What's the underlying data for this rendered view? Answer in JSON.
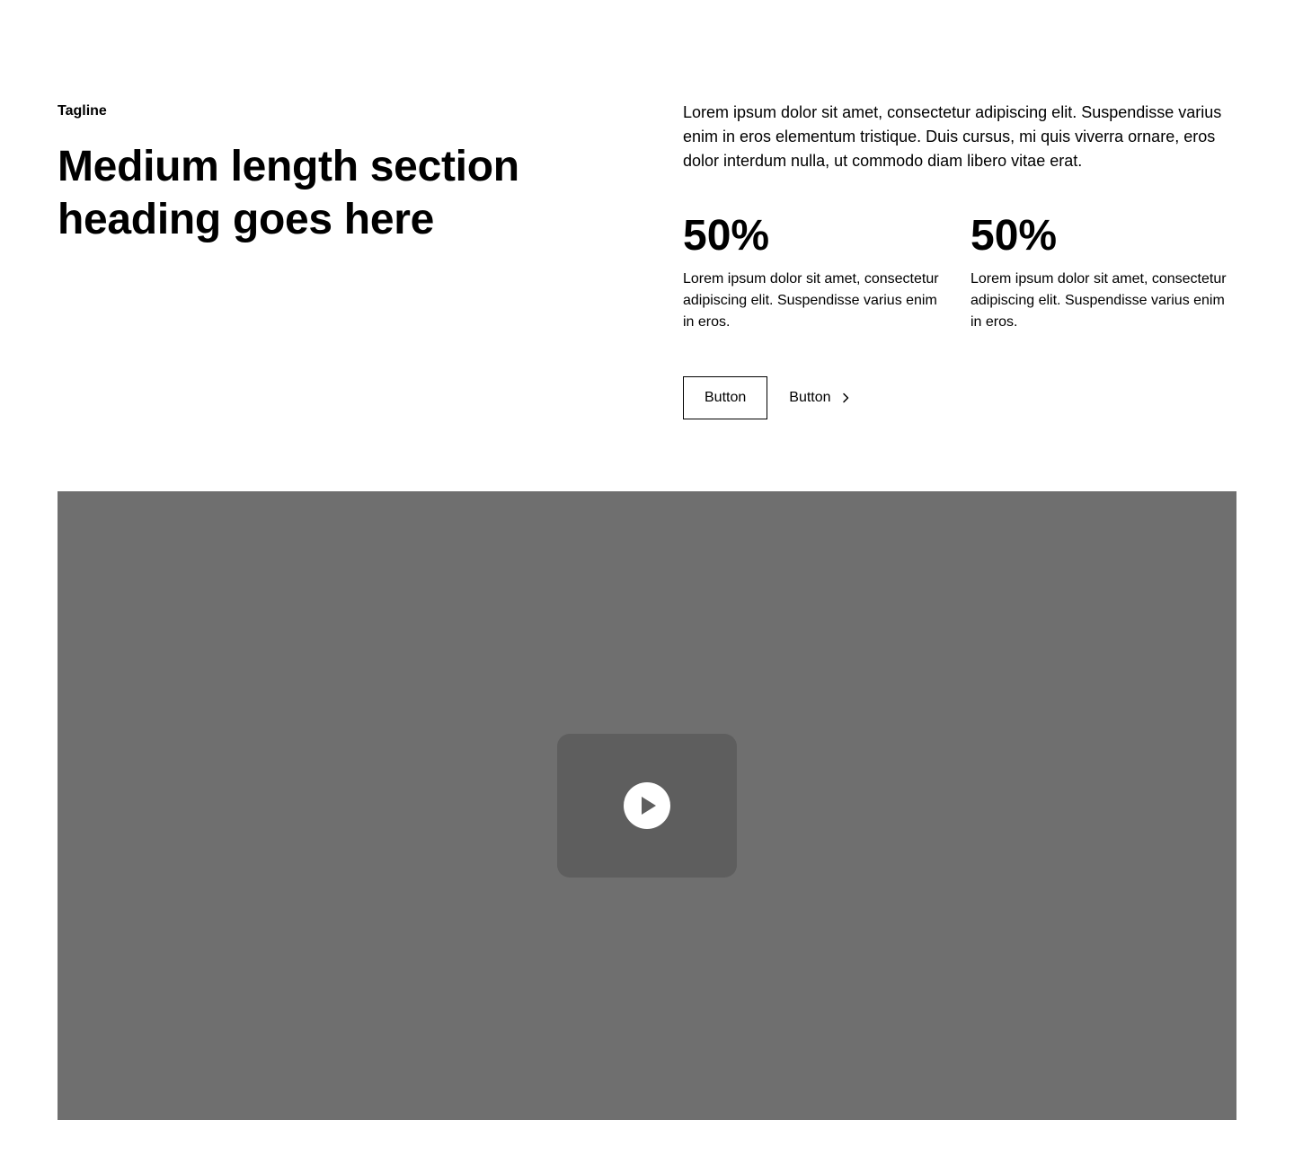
{
  "header": {
    "tagline": "Tagline",
    "heading": "Medium length section heading goes here"
  },
  "intro": {
    "text": "Lorem ipsum dolor sit amet, consectetur adipiscing elit. Suspendisse varius enim in eros elementum tristique. Duis cursus, mi quis viverra ornare, eros dolor interdum nulla, ut commodo diam libero vitae erat."
  },
  "stats": [
    {
      "value": "50%",
      "description": "Lorem ipsum dolor sit amet, consectetur adipiscing elit. Suspendisse varius enim in eros."
    },
    {
      "value": "50%",
      "description": "Lorem ipsum dolor sit amet, consectetur adipiscing elit. Suspendisse varius enim in eros."
    }
  ],
  "actions": {
    "secondary_label": "Button",
    "link_label": "Button",
    "link_icon": "chevron-right-icon"
  },
  "media": {
    "play_icon": "play-icon",
    "background_color": "#6f6f6f",
    "card_color": "#5e5e5e"
  }
}
